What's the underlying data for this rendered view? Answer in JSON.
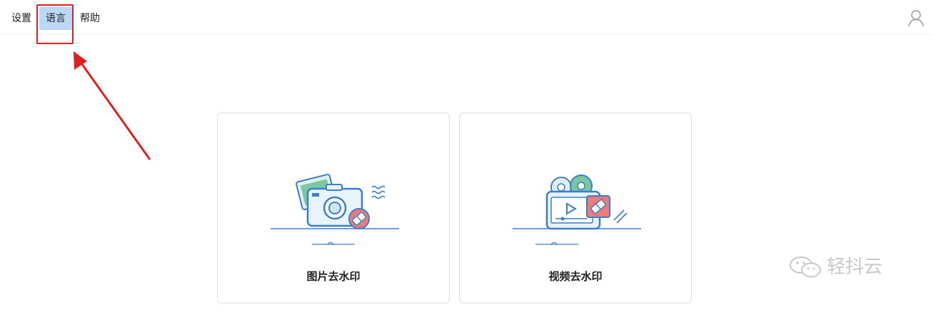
{
  "menu": {
    "items": [
      {
        "label": "设置"
      },
      {
        "label": "语言"
      },
      {
        "label": "帮助"
      }
    ]
  },
  "header": {
    "user_icon": "user-icon"
  },
  "cards": [
    {
      "label": "图片去水印",
      "icon": "camera-eraser-icon"
    },
    {
      "label": "视频去水印",
      "icon": "video-eraser-icon"
    }
  ],
  "watermark": {
    "text": "轻抖云",
    "icon": "wechat-icon"
  },
  "colors": {
    "highlight_red": "#e02020",
    "active_menu_bg": "#bcd8f4",
    "illustration_blue": "#3b7fc9",
    "eraser_pink": "#ef7a7a"
  }
}
